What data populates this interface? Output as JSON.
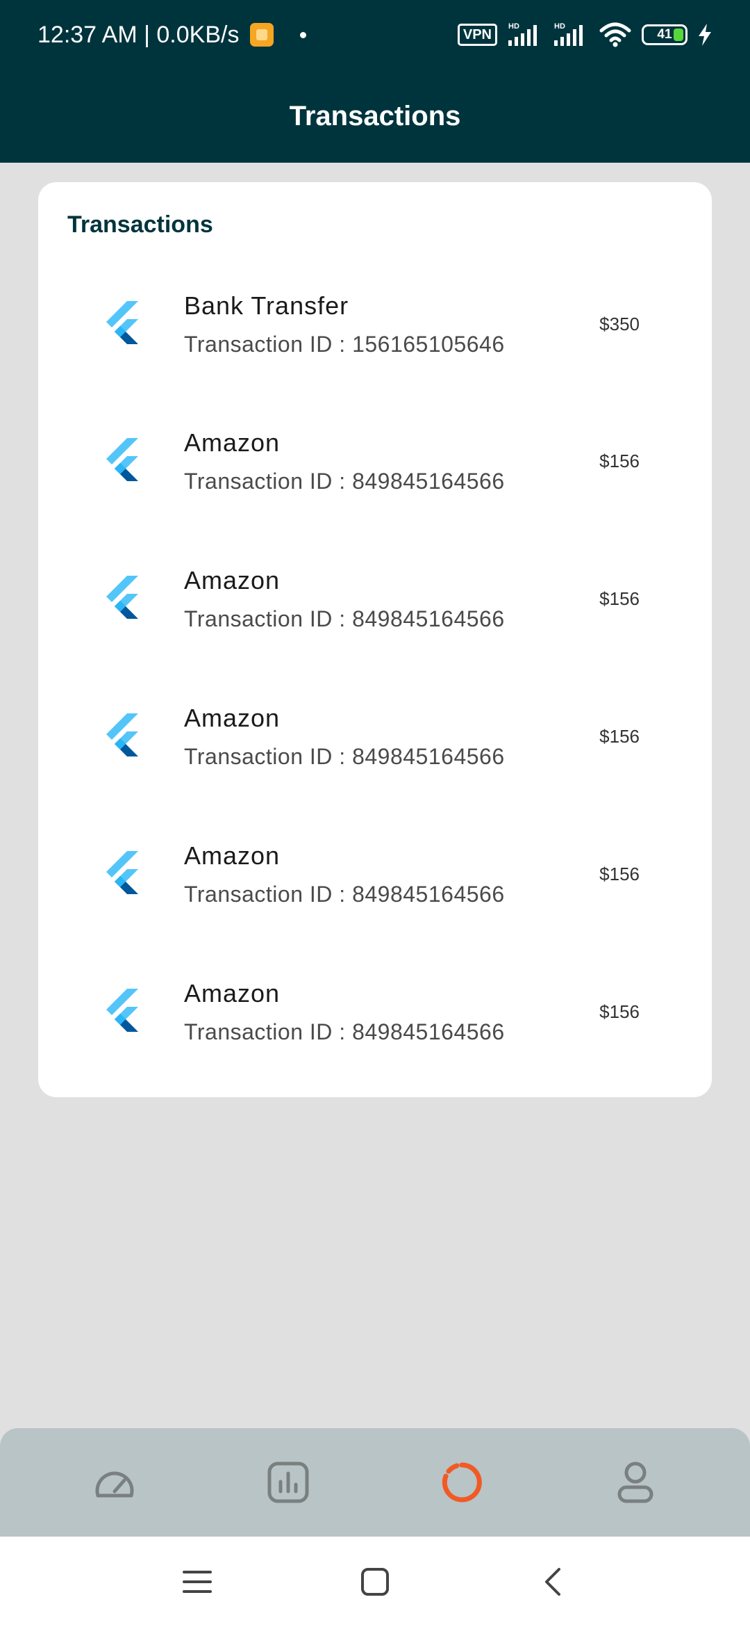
{
  "status_bar": {
    "time_speed": "12:37 AM | 0.0KB/s",
    "vpn": "VPN",
    "battery": "41"
  },
  "app_bar": {
    "title": "Transactions"
  },
  "card": {
    "title": "Transactions",
    "transactions": [
      {
        "name": "Bank Transfer",
        "id": "Transaction ID : 156165105646",
        "amount": "$350"
      },
      {
        "name": "Amazon",
        "id": "Transaction ID : 849845164566",
        "amount": "$156"
      },
      {
        "name": "Amazon",
        "id": "Transaction ID : 849845164566",
        "amount": "$156"
      },
      {
        "name": "Amazon",
        "id": "Transaction ID : 849845164566",
        "amount": "$156"
      },
      {
        "name": "Amazon",
        "id": "Transaction ID : 849845164566",
        "amount": "$156"
      },
      {
        "name": "Amazon",
        "id": "Transaction ID : 849845164566",
        "amount": "$156"
      }
    ]
  },
  "bottom_nav": {
    "items": [
      {
        "icon": "speedometer-icon",
        "active": false
      },
      {
        "icon": "bar-chart-icon",
        "active": false
      },
      {
        "icon": "donut-chart-icon",
        "active": true
      },
      {
        "icon": "profile-icon",
        "active": false
      }
    ],
    "active_color": "#f15a24",
    "inactive_color": "#7a7f80"
  },
  "colors": {
    "header_bg": "#00343d",
    "page_bg": "#e0e0e0",
    "card_bg": "#ffffff",
    "nav_bg": "#b8c4c6"
  }
}
